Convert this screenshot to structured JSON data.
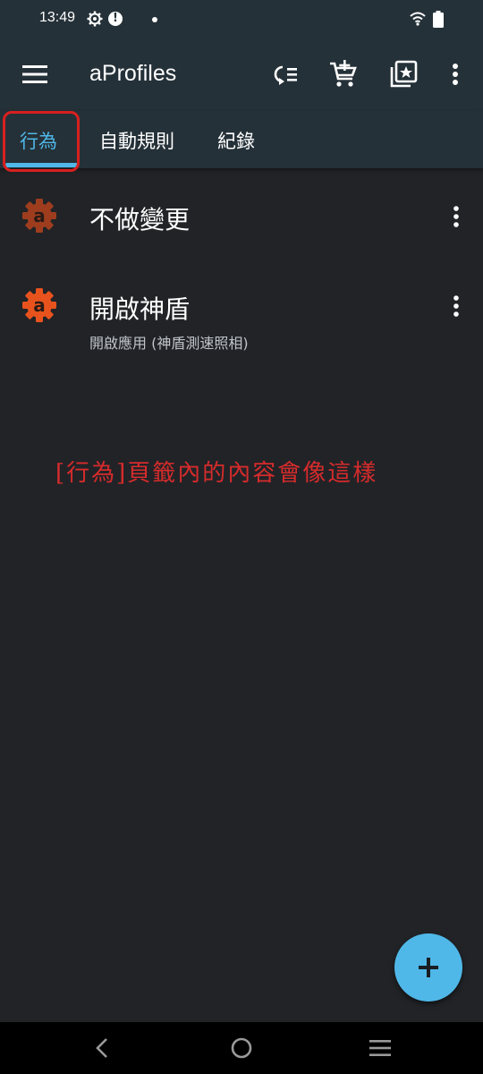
{
  "status_bar": {
    "time": "13:49",
    "icons": [
      "gear-icon",
      "alert-icon",
      "dot-icon",
      "wifi-icon",
      "battery-icon"
    ]
  },
  "app_bar": {
    "title": "aProfiles",
    "actions": [
      "profile-switch-icon",
      "add-to-cart-icon",
      "collections-icon",
      "more-vert-icon"
    ]
  },
  "tabs": [
    {
      "label": "行為",
      "active": true
    },
    {
      "label": "自動規則",
      "active": false
    },
    {
      "label": "紀錄",
      "active": false
    }
  ],
  "actions": [
    {
      "title": "不做變更",
      "subtitle": ""
    },
    {
      "title": "開啟神盾",
      "subtitle": "開啟應用 (神盾測速照相)"
    }
  ],
  "annotation": "[行為]頁籤內的內容會像這樣",
  "fab": {
    "icon": "plus-icon"
  },
  "nav_bar": {
    "icons": [
      "back-icon",
      "home-icon",
      "recents-icon"
    ]
  },
  "colors": {
    "accent": "#4fb8e8",
    "app_bar_bg": "#253138",
    "background": "#212327",
    "icon_orange": "#e8531d",
    "highlight_red": "#d8201f"
  }
}
